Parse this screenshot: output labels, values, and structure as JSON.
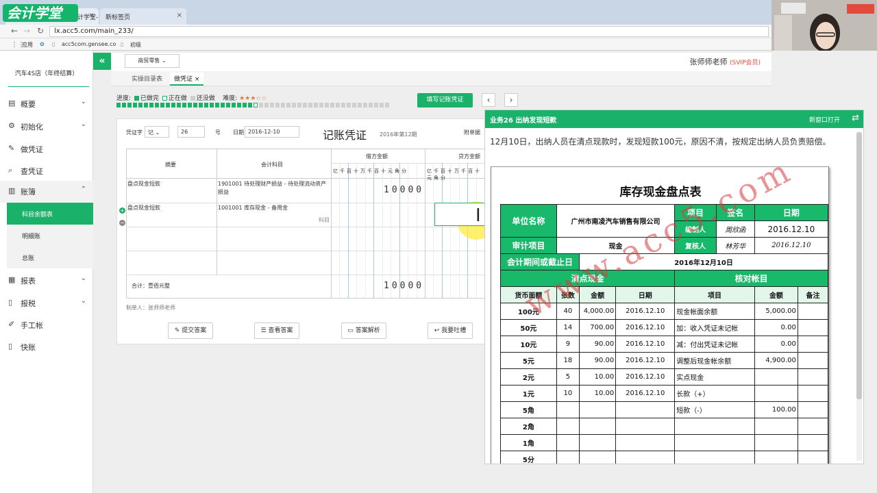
{
  "browser": {
    "tabs": [
      {
        "label": "会计学堂-会计",
        "close": "×"
      },
      {
        "label": "新标签页",
        "close": "×"
      }
    ],
    "logo_text": "会计学堂",
    "url": "lx.acc5.com/main_233/",
    "bookmarks": [
      "应用",
      "acc5com.gensee.co",
      "初级"
    ]
  },
  "sidebar": {
    "store_name": "汽车4S店（年终结算）",
    "items": [
      {
        "label": "概要",
        "icon": "grid-icon",
        "chevron": "⌄"
      },
      {
        "label": "初始化",
        "icon": "gear-icon",
        "chevron": "⌄"
      },
      {
        "label": "做凭证",
        "icon": "pen-icon"
      },
      {
        "label": "查凭证",
        "icon": "search-icon"
      },
      {
        "label": "账簿",
        "icon": "book-icon",
        "chevron": "⌃"
      },
      {
        "label": "报表",
        "icon": "report-icon",
        "chevron": "⌄"
      },
      {
        "label": "报税",
        "icon": "tax-icon",
        "chevron": "⌄"
      },
      {
        "label": "手工帐",
        "icon": "pencil-icon"
      },
      {
        "label": "快账",
        "icon": "file-icon"
      }
    ],
    "subitems": [
      {
        "label": "科目余额表",
        "active": true
      },
      {
        "label": "明细账",
        "active": false
      },
      {
        "label": "总账",
        "active": false
      }
    ]
  },
  "topbar": {
    "collapse_icon": "«",
    "dropdown": "商贸零售 ⌄",
    "user": "张师师老师",
    "vip": "(SVIP会员)"
  },
  "subtabs": [
    {
      "label": "实操目录表"
    },
    {
      "label": "做凭证",
      "close": "×"
    }
  ],
  "progress": {
    "label": "进度:",
    "done": "已做完",
    "doing": "正在做",
    "todo": "还没做",
    "difficulty_label": "难度:",
    "difficulty_stars": "★★★☆☆",
    "done_count": 25,
    "total": 50,
    "colors": {
      "done": "#1ab26b",
      "doing": "#ffffff",
      "todo": "#cfcfcf"
    }
  },
  "voucher": {
    "fill_button": "填写记账凭证",
    "prev": "‹",
    "next": "›",
    "word_label": "凭证字",
    "word_value": "记",
    "number_value": "26",
    "number_suffix": "号",
    "date_label": "日期",
    "date_value": "2016-12-10",
    "title": "记账凭证",
    "period": "2016年第12期",
    "attach_label": "附单据",
    "headers": {
      "summary": "摘要",
      "account": "会计科目",
      "debit": "借方金额",
      "credit": "贷方金额",
      "digits": "亿千百十万千百十元角分"
    },
    "rows": [
      {
        "summary": "盘点现金短款",
        "account": "1901001 待处理财产损益 - 待处理流动资产损益",
        "debit": "10000",
        "credit": ""
      },
      {
        "summary": "盘点现金短款",
        "account": "1001001 库存现金 - 备用金",
        "account_hint": "科目",
        "debit": "",
        "credit": ""
      }
    ],
    "total_label": "合计：壹佰元整",
    "total_debit": "10000",
    "preparer": "制单人：张师师老师",
    "buttons": [
      "提交答案",
      "查看答案",
      "答案解析",
      "我要吐槽"
    ]
  },
  "panel": {
    "title": "业务26 出纳发现短款",
    "open_new": "新窗口打开",
    "swap_icon": "⇄",
    "description": "12月10日，出纳人员在清点现款时，发现短款100元，原因不清，按规定出纳人员负责赔偿。",
    "doc": {
      "title": "库存现金盘点表",
      "unit_label": "单位名称",
      "unit_value": "广州市南凌汽车销售有限公司",
      "item_label": "项目",
      "sign_label": "签名",
      "date_label": "日期",
      "preparer_label": "编制人",
      "preparer_sign": "周欣函",
      "preparer_date": "2016.12.10",
      "audit_item_label": "审计项目",
      "audit_item_value": "现金",
      "reviewer_label": "复核人",
      "reviewer_sign": "林芳华",
      "reviewer_date": "2016.12.10",
      "period_label": "会计期间或截止日",
      "period_value": "2016年12月10日",
      "left_section": "清点现金",
      "right_section": "核对帐目",
      "col_denom": "货币面额",
      "col_count": "张数",
      "col_amount": "金额",
      "col_date": "日期",
      "col_item": "项目",
      "col_amount2": "金额",
      "col_note": "备注",
      "rows": [
        {
          "denom": "100元",
          "count": "40",
          "amount": "4,000.00",
          "date": "2016.12.10",
          "item": "现金帐面余额",
          "amount2": "5,000.00"
        },
        {
          "denom": "50元",
          "count": "14",
          "amount": "700.00",
          "date": "2016.12.10",
          "item": "加：收入凭证未记帐",
          "amount2": "0.00"
        },
        {
          "denom": "10元",
          "count": "9",
          "amount": "90.00",
          "date": "2016.12.10",
          "item": "减：付出凭证未记帐",
          "amount2": "0.00"
        },
        {
          "denom": "5元",
          "count": "18",
          "amount": "90.00",
          "date": "2016.12.10",
          "item": "调整后现金帐余额",
          "amount2": "4,900.00"
        },
        {
          "denom": "2元",
          "count": "5",
          "amount": "10.00",
          "date": "2016.12.10",
          "item": "实点现金",
          "amount2": ""
        },
        {
          "denom": "1元",
          "count": "10",
          "amount": "10.00",
          "date": "2016.12.10",
          "item": "长款（+）",
          "amount2": ""
        },
        {
          "denom": "5角",
          "count": "",
          "amount": "",
          "date": "",
          "item": "短款（-）",
          "amount2": "100.00"
        },
        {
          "denom": "2角",
          "count": "",
          "amount": "",
          "date": "",
          "item": "",
          "amount2": ""
        },
        {
          "denom": "1角",
          "count": "",
          "amount": "",
          "date": "",
          "item": "",
          "amount2": ""
        },
        {
          "denom": "5分",
          "count": "",
          "amount": "",
          "date": "",
          "item": "",
          "amount2": ""
        }
      ],
      "watermark": "www.acc5.com"
    }
  }
}
